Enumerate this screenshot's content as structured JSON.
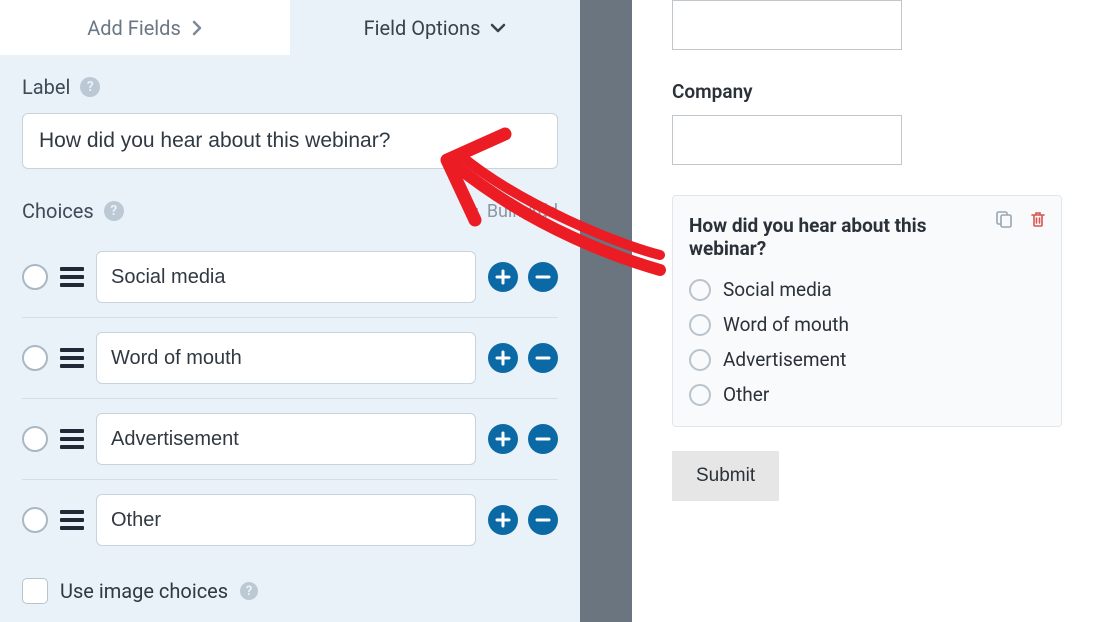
{
  "tabs": {
    "add_fields_label": "Add Fields",
    "field_options_label": "Field Options"
  },
  "label_section": {
    "title": "Label",
    "value": "How did you hear about this webinar?"
  },
  "choices_section": {
    "title": "Choices",
    "bulk_add_label": "Bulk Add",
    "items": [
      {
        "label": "Social media"
      },
      {
        "label": "Word of mouth"
      },
      {
        "label": "Advertisement"
      },
      {
        "label": "Other"
      }
    ],
    "use_image_choices_label": "Use image choices"
  },
  "preview": {
    "company_label": "Company",
    "question_title": "How did you hear about this webinar?",
    "options": [
      "Social media",
      "Word of mouth",
      "Advertisement",
      "Other"
    ],
    "submit_label": "Submit"
  },
  "icons": {
    "help_glyph": "?"
  }
}
